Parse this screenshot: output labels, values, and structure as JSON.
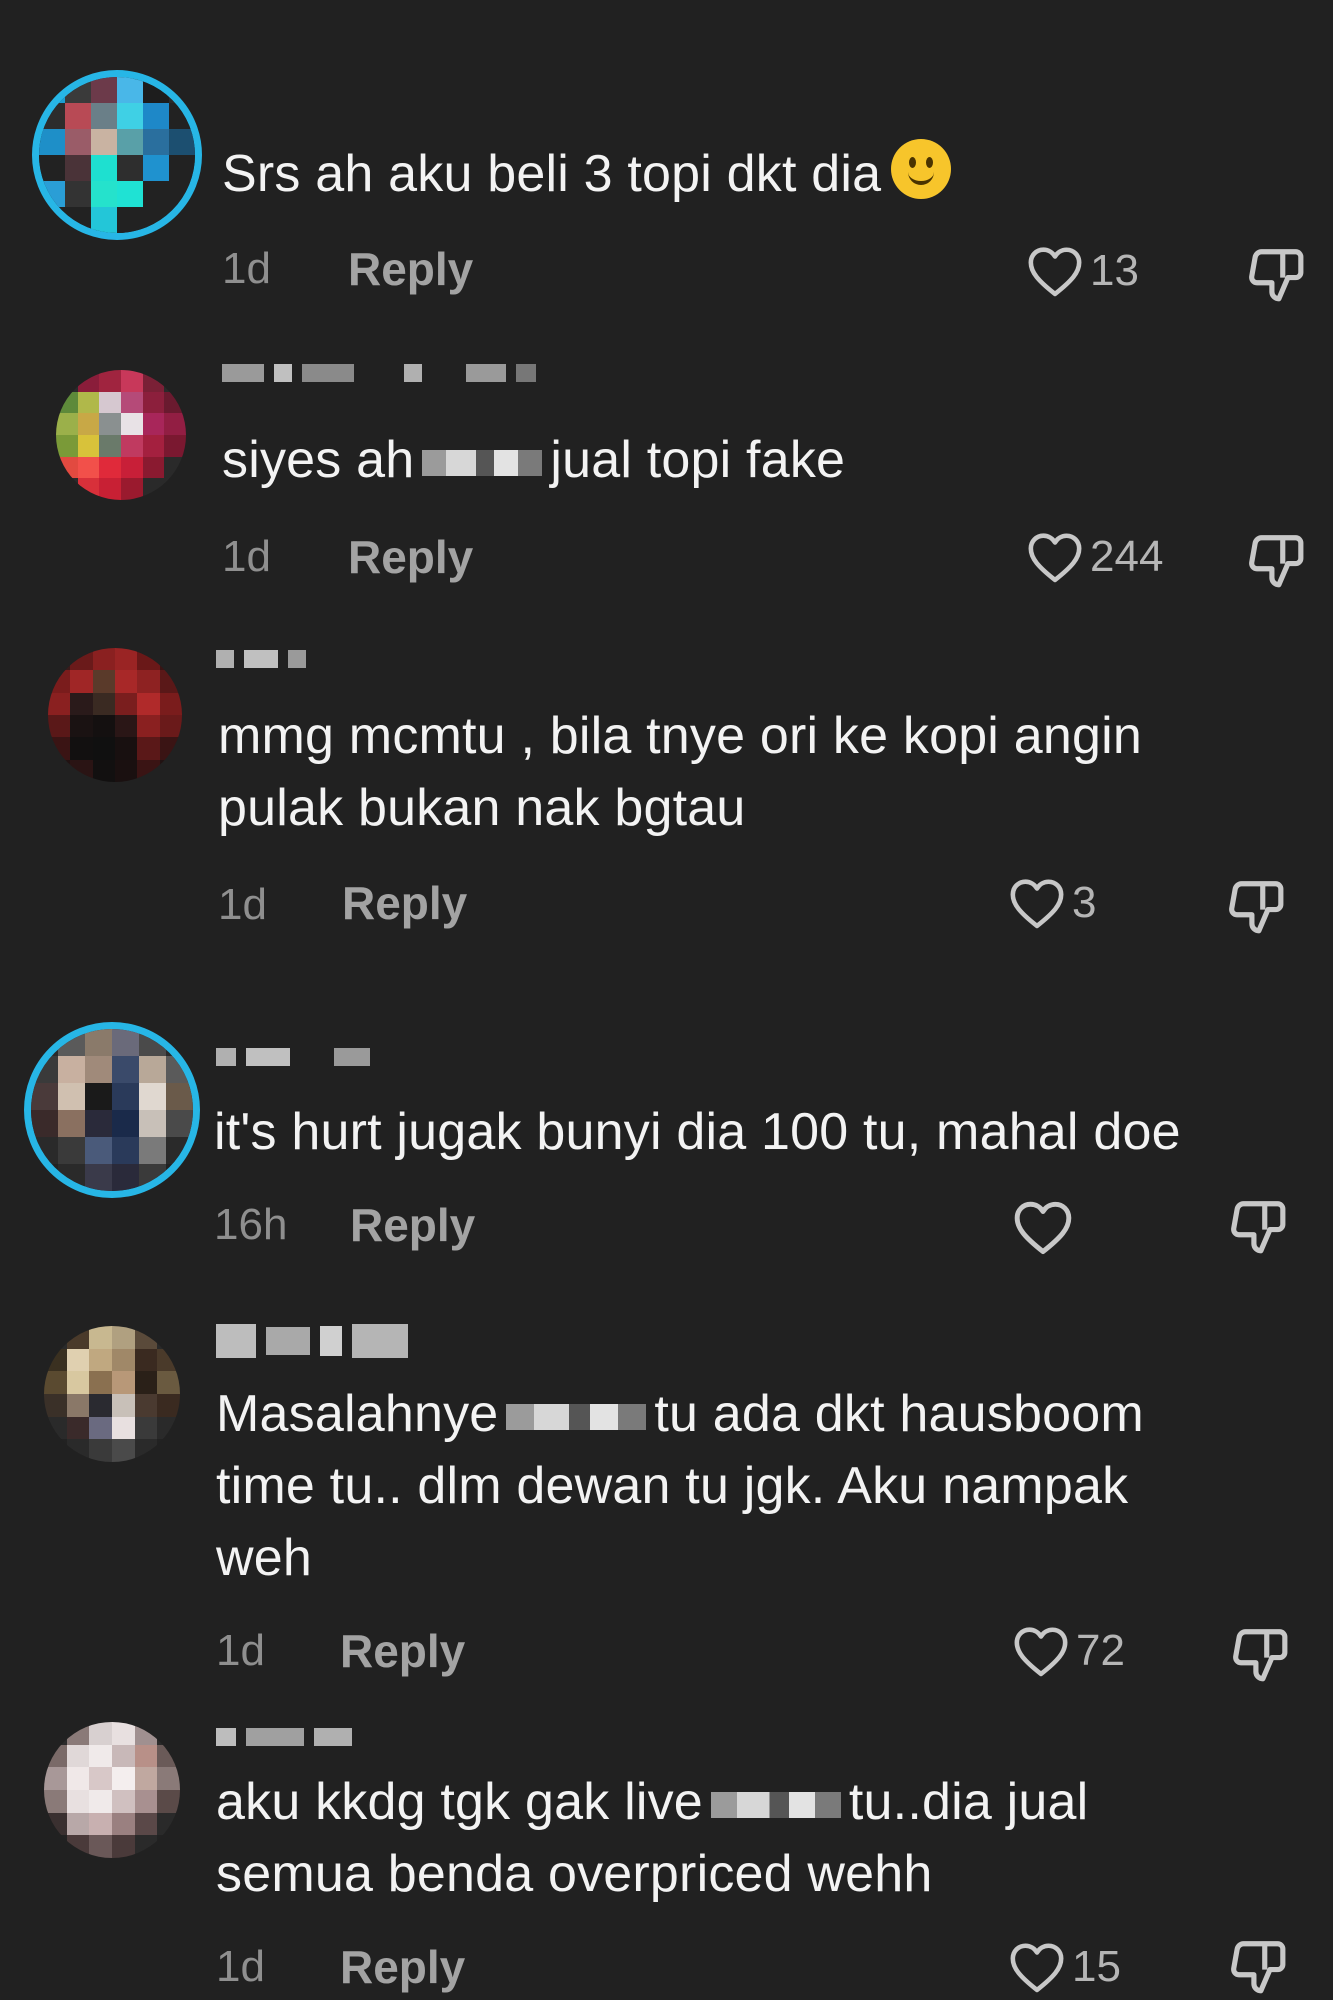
{
  "reply_label": "Reply",
  "colors": {
    "background": "#212121",
    "text": "#f3f3f3",
    "meta": "#8f8f8f",
    "ring": "#27b6e6"
  },
  "comments": [
    {
      "text": "Srs ah aku beli 3 topi dkt dia",
      "emoji": "slightly-smiling-face",
      "time": "1d",
      "likes": "13"
    },
    {
      "text_before": "siyes ah",
      "text_after": "jual topi fake",
      "time": "1d",
      "likes": "244"
    },
    {
      "text": "mmg mcmtu , bila tnye ori ke kopi angin\npulak bukan nak bgtau",
      "time": "1d",
      "likes": "3"
    },
    {
      "text": "it's hurt jugak bunyi dia 100 tu, mahal doe",
      "time": "16h",
      "likes": ""
    },
    {
      "text_before": "Masalahnye",
      "text_after": "tu ada dkt hausboom",
      "text_rest": "time tu.. dlm dewan tu jgk. Aku nampak\nweh",
      "time": "1d",
      "likes": "72"
    },
    {
      "text_before": "aku kkdg tgk gak live",
      "text_after": "tu..dia jual",
      "text_rest": "semua benda overpriced wehh",
      "time": "1d",
      "likes": "15"
    }
  ]
}
